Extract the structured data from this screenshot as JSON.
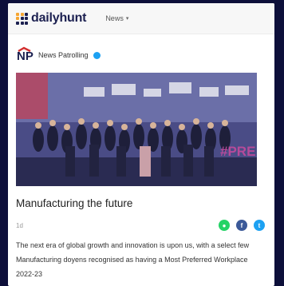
{
  "app": {
    "logo_text": "dailyhunt",
    "nav_menu_label": "News"
  },
  "publisher": {
    "name": "News Patrolling",
    "logo_text": "NP",
    "verified": true
  },
  "article": {
    "headline": "Manufacturing the future",
    "time": "1d",
    "summary": "The next era of global growth and innovation is upon us, with a select few Manufacturing doyens recognised as having a Most Preferred Workplace 2022-23",
    "image_overlay_text": "#PRE"
  },
  "share_icons": [
    {
      "name": "whatsapp-icon",
      "color": "#25d366",
      "glyph": "●"
    },
    {
      "name": "facebook-icon",
      "color": "#3b5998",
      "glyph": "f"
    },
    {
      "name": "twitter-icon",
      "color": "#1da1f2",
      "glyph": "t"
    }
  ],
  "colors": {
    "page_bg": "#0d0f3a",
    "brand_navy": "#1c2050",
    "brand_orange": "#f6a531",
    "verified_blue": "#1da1f2"
  }
}
